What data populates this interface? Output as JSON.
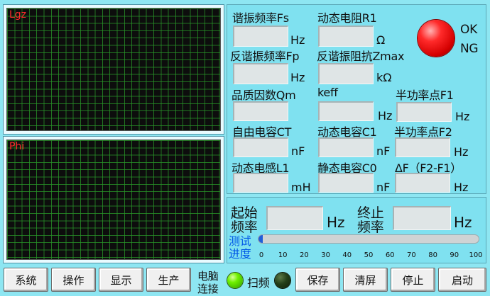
{
  "plots": {
    "top_label": "Lgz",
    "bottom_label": "Phi"
  },
  "params": {
    "fs_label": "谐振频率Fs",
    "fs_unit": "Hz",
    "r1_label": "动态电阻R1",
    "r1_unit": "Ω",
    "fp_label": "反谐振频率Fp",
    "fp_unit": "Hz",
    "zmax_label": "反谐振阻抗Zmax",
    "zmax_unit": "kΩ",
    "qm_label": "品质因数Qm",
    "keff_label": "keff",
    "keff_unit": "Hz",
    "f1_label": "半功率点F1",
    "f1_unit": "Hz",
    "ct_label": "自由电容CT",
    "ct_unit": "nF",
    "c1_label": "动态电容C1",
    "c1_unit": "nF",
    "f2_label": "半功率点F2",
    "f2_unit": "Hz",
    "l1_label": "动态电感L1",
    "l1_unit": "mH",
    "c0_label": "静态电容C0",
    "c0_unit": "nF",
    "df_label": "ΔF（F2-F1）",
    "df_unit": "Hz"
  },
  "status": {
    "ok": "OK",
    "ng": "NG",
    "led_color": "#ff1a1a"
  },
  "sweep": {
    "start_label_1": "起始",
    "start_label_2": "频率",
    "start_unit": "Hz",
    "end_label_1": "终止",
    "end_label_2": "频率",
    "end_unit": "Hz",
    "progress_label_1": "测试",
    "progress_label_2": "进度",
    "progress_value": 2,
    "ticks": [
      "0",
      "10",
      "20",
      "30",
      "40",
      "50",
      "60",
      "70",
      "80",
      "90",
      "100"
    ]
  },
  "toolbar": {
    "system": "系统",
    "operate": "操作",
    "display": "显示",
    "produce": "生产",
    "conn_1": "电脑",
    "conn_2": "连接",
    "scan": "扫频",
    "save": "保存",
    "clear": "清屏",
    "stop": "停止",
    "start": "启动"
  },
  "colors": {
    "accent": "#0057e7",
    "led_green": "#3fe000",
    "led_dark": "#1a3a10"
  }
}
